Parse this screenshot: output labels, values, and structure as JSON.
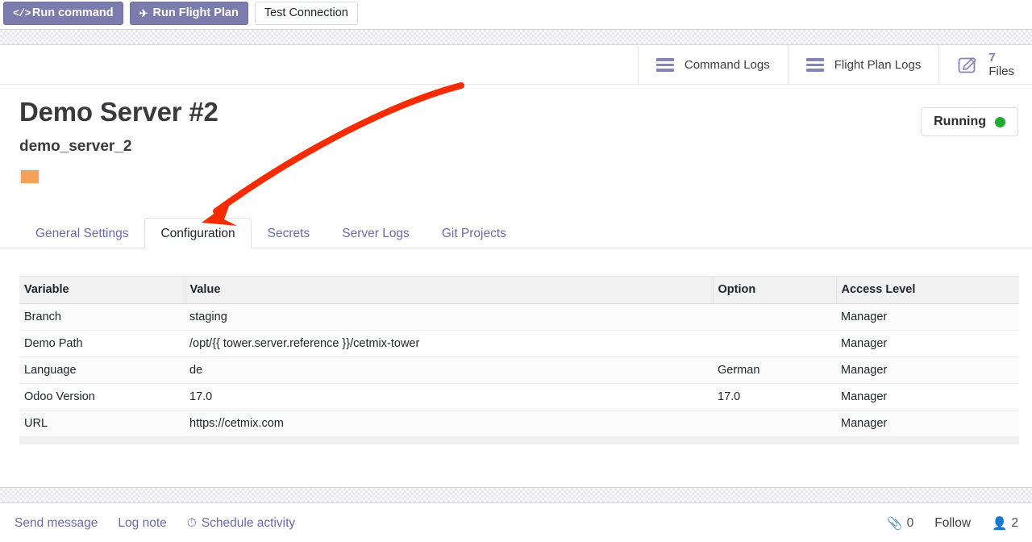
{
  "toolbar": {
    "buttons": [
      {
        "label": "Run command",
        "icon": "code-icon",
        "style": "primary"
      },
      {
        "label": "Run Flight Plan",
        "icon": "airplane-icon",
        "style": "primary"
      },
      {
        "label": "Test Connection",
        "icon": "",
        "style": "secondary"
      }
    ]
  },
  "stat_buttons": [
    {
      "label": "Command Logs",
      "icon": "list-lines-icon"
    },
    {
      "label": "Flight Plan Logs",
      "icon": "list-lines-icon"
    },
    {
      "icon": "edit-square-icon",
      "count": "7",
      "label": "Files"
    }
  ],
  "record": {
    "title": "Demo Server #2",
    "reference": "demo_server_2",
    "color_swatch": "#f2a25c",
    "status": {
      "label": "Running",
      "dot_color": "#22a833"
    }
  },
  "tabs": [
    {
      "label": "General Settings",
      "active": false
    },
    {
      "label": "Configuration",
      "active": true
    },
    {
      "label": "Secrets",
      "active": false
    },
    {
      "label": "Server Logs",
      "active": false
    },
    {
      "label": "Git Projects",
      "active": false
    }
  ],
  "table": {
    "columns": [
      "Variable",
      "Value",
      "Option",
      "Access Level"
    ],
    "rows": [
      {
        "variable": "Branch",
        "value": "staging",
        "option": "",
        "access": "Manager"
      },
      {
        "variable": "Demo Path",
        "value": "/opt/{{ tower.server.reference }}/cetmix-tower",
        "option": "",
        "access": "Manager"
      },
      {
        "variable": "Language",
        "value": "de",
        "option": "German",
        "access": "Manager"
      },
      {
        "variable": "Odoo Version",
        "value": "17.0",
        "option": "17.0",
        "access": "Manager"
      },
      {
        "variable": "URL",
        "value": "https://cetmix.com",
        "option": "",
        "access": "Manager"
      }
    ]
  },
  "chatter": {
    "send_message": "Send message",
    "log_note": "Log note",
    "schedule_activity": "Schedule activity",
    "attachment_count": "0",
    "follow": "Follow",
    "follower_count": "2"
  },
  "colors": {
    "brand_purple": "#7c7bad",
    "link_purple": "#6b6aa8",
    "annotation_red": "#f62b00",
    "status_green": "#22a833",
    "swatch_orange": "#f2a25c"
  }
}
